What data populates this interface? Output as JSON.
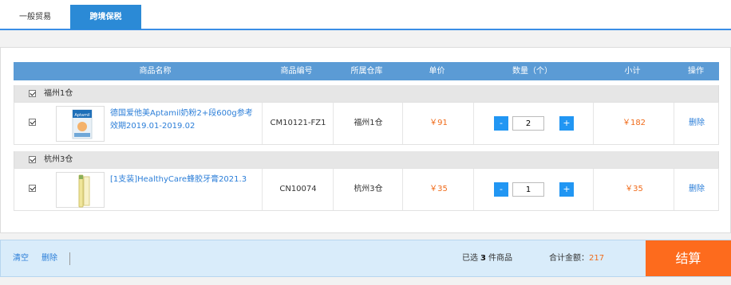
{
  "tabs": [
    {
      "label": "一般贸易",
      "active": false
    },
    {
      "label": "跨境保税",
      "active": true
    }
  ],
  "table": {
    "headers": {
      "name": "商品名称",
      "code": "商品编号",
      "warehouse": "所属仓库",
      "price": "单价",
      "qty": "数量（个）",
      "subtotal": "小计",
      "action": "操作"
    }
  },
  "groups": [
    {
      "name": "福州1仓",
      "checked": true,
      "items": [
        {
          "checked": true,
          "image_icon": "milk-powder-box-image",
          "name": "德国爱他美Aptamil奶粉2+段600g参考效期2019.01-2019.02",
          "code": "CM10121-FZ1",
          "warehouse": "福州1仓",
          "price": "￥91",
          "qty": "2",
          "subtotal": "￥182",
          "action": "删除"
        }
      ]
    },
    {
      "name": "杭州3仓",
      "checked": true,
      "items": [
        {
          "checked": true,
          "image_icon": "toothpaste-tube-image",
          "name": "[1支装]HealthyCare蜂胶牙膏2021.3",
          "code": "CN10074",
          "warehouse": "杭州3仓",
          "price": "￥35",
          "qty": "1",
          "subtotal": "￥35",
          "action": "删除"
        }
      ]
    }
  ],
  "qty_controls": {
    "minus": "-",
    "plus": "+"
  },
  "footer": {
    "clear": "清空",
    "delete": "删除",
    "selected_prefix": "已选",
    "selected_count": "3",
    "selected_suffix": "件商品",
    "total_label": "合计金额：",
    "total_amount": "217",
    "checkout": "结算"
  },
  "colors": {
    "tab_active": "#2b8ad6",
    "header_bg": "#5b9bd5",
    "price": "#f06b1a",
    "qty_button": "#2196f3",
    "checkout": "#fd6b1d",
    "link": "#2b7ed8"
  }
}
